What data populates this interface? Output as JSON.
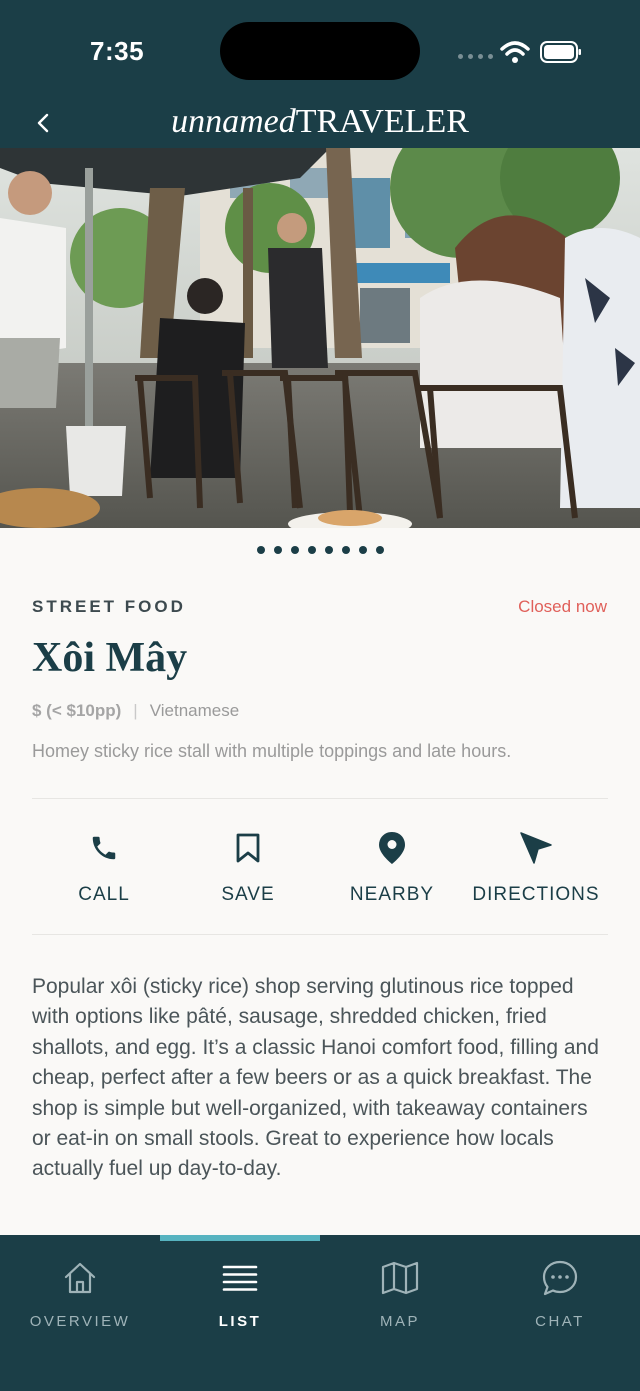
{
  "status_bar": {
    "time": "7:35"
  },
  "header": {
    "brand_italic": "unnamed",
    "brand_caps": "TRAVELER"
  },
  "carousel": {
    "slide_count": 8,
    "active_index": 0
  },
  "place": {
    "category": "STREET FOOD",
    "status": "Closed now",
    "name": "Xôi Mây",
    "price": "$ (< $10pp)",
    "separator": "|",
    "cuisine": "Vietnamese",
    "tagline": "Homey sticky rice stall with multiple toppings and late hours.",
    "description": "Popular xôi (sticky rice) shop serving glutinous rice topped with options like pâté, sausage, shredded chicken, fried shallots, and egg. It’s a classic Hanoi comfort food, filling and cheap, perfect after a few beers or as a quick breakfast. The shop is simple but well-organized, with takeaway containers or eat-in on small stools. Great to experience how locals actually fuel up day-to-day."
  },
  "actions": [
    {
      "label": "CALL",
      "icon": "phone-icon"
    },
    {
      "label": "SAVE",
      "icon": "bookmark-icon"
    },
    {
      "label": "NEARBY",
      "icon": "map-pin-icon"
    },
    {
      "label": "DIRECTIONS",
      "icon": "navigation-arrow-icon"
    }
  ],
  "bottom_nav": [
    {
      "label": "OVERVIEW",
      "icon": "home-icon",
      "active": false
    },
    {
      "label": "LIST",
      "icon": "list-icon",
      "active": true
    },
    {
      "label": "MAP",
      "icon": "map-icon",
      "active": false
    },
    {
      "label": "CHAT",
      "icon": "chat-bubble-icon",
      "active": false
    }
  ],
  "colors": {
    "primary": "#1b3e47",
    "accent": "#56b3c0",
    "status_closed": "#e0605a",
    "background": "#faf9f7"
  }
}
